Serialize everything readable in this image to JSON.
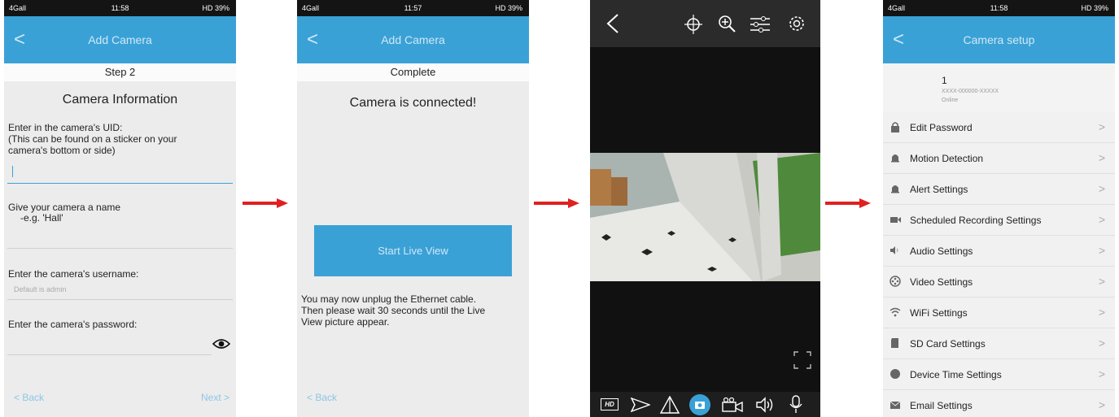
{
  "screen1": {
    "status": {
      "left": "4Gall",
      "time": "11:58",
      "right": "HD 39%"
    },
    "nav": {
      "back": "<",
      "title": "Add Camera"
    },
    "step": "Step 2",
    "heading": "Camera Information",
    "uid_label_1": "Enter in the camera's UID:",
    "uid_label_2": "(This can be found on a sticker on your",
    "uid_label_3": "camera's bottom or side)",
    "name_label": "Give your camera a name",
    "name_example": "-e.g. 'Hall'",
    "username_label": "Enter the camera's username:",
    "username_placeholder": "Default is admin",
    "password_label": "Enter the camera's password:",
    "back_link": "< Back",
    "next_link": "Next >"
  },
  "screen2": {
    "status": {
      "left": "4Gall",
      "time": "11:57",
      "right": "HD 39%"
    },
    "nav": {
      "back": "<",
      "title": "Add Camera"
    },
    "step": "Complete",
    "connected": "Camera is connected!",
    "start_button": "Start Live View",
    "info_1": "You may now unplug the Ethernet cable.",
    "info_2": "Then please wait 30 seconds until the Live",
    "info_3": "View picture appear.",
    "back_link": "< Back"
  },
  "screen3": {
    "top_icons": [
      "back-icon",
      "ptz-icon",
      "zoom-in-icon",
      "adjust-icon",
      "settings-icon"
    ],
    "bottom_icons": [
      "hd-icon",
      "send-icon",
      "flip-icon",
      "snapshot-icon",
      "record-icon",
      "speaker-icon",
      "mic-icon"
    ],
    "hd": "HD"
  },
  "screen4": {
    "status": {
      "left": "4Gall",
      "time": "11:58",
      "right": "HD 39%"
    },
    "nav": {
      "back": "<",
      "title": "Camera setup"
    },
    "camera_name": "1",
    "camera_uid": "XXXX-000000-XXXXX",
    "camera_state": "Online",
    "chevron": ">",
    "items": [
      {
        "label": "Edit Password",
        "icon": "lock-icon"
      },
      {
        "label": "Motion Detection",
        "icon": "bell-icon"
      },
      {
        "label": "Alert Settings",
        "icon": "bell-icon"
      },
      {
        "label": "Scheduled Recording Settings",
        "icon": "video-icon"
      },
      {
        "label": "Audio Settings",
        "icon": "speaker-icon"
      },
      {
        "label": "Video Settings",
        "icon": "film-icon"
      },
      {
        "label": "WiFi Settings",
        "icon": "wifi-icon"
      },
      {
        "label": "SD Card Settings",
        "icon": "sdcard-icon"
      },
      {
        "label": "Device Time Settings",
        "icon": "clock-icon"
      },
      {
        "label": "Email Settings",
        "icon": "mail-icon"
      }
    ]
  },
  "colors": {
    "accent": "#3aa1d6",
    "arrow": "#e02020"
  }
}
